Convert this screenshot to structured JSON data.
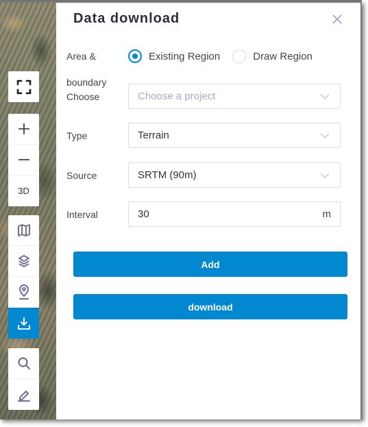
{
  "toolbar": {
    "groups": [
      [
        {
          "name": "fullscreen",
          "icon": "fullscreen-icon"
        }
      ],
      [
        {
          "name": "zoom-in",
          "icon": "plus-icon"
        },
        {
          "name": "zoom-out",
          "icon": "minus-icon"
        },
        {
          "name": "3d",
          "label": "3D"
        }
      ],
      [
        {
          "name": "basemap",
          "icon": "map-icon"
        },
        {
          "name": "layers",
          "icon": "layers-icon"
        },
        {
          "name": "location",
          "icon": "location-pin-icon"
        },
        {
          "name": "download",
          "icon": "download-icon",
          "active": true
        }
      ],
      [
        {
          "name": "search",
          "icon": "search-icon"
        },
        {
          "name": "draw",
          "icon": "edit-icon"
        }
      ]
    ],
    "label_3d": "3D"
  },
  "panel": {
    "title": "Data download",
    "close_icon": "close-icon",
    "area": {
      "label": "Area &",
      "options": [
        {
          "label": "Existing Region",
          "checked": true
        },
        {
          "label": "Draw Region",
          "checked": false
        }
      ]
    },
    "boundary": {
      "label_line1": "boundary",
      "label_line2": "Choose",
      "placeholder": "Choose a project",
      "value": ""
    },
    "type": {
      "label": "Type",
      "value": "Terrain"
    },
    "source": {
      "label": "Source",
      "value": "SRTM (90m)"
    },
    "interval": {
      "label": "Interval",
      "value": "30",
      "unit": "m"
    },
    "add_label": "Add",
    "download_label": "download"
  },
  "colors": {
    "accent": "#0288d1",
    "icon": "#6e7197",
    "title": "#2a2d3e",
    "border": "#dcdce6",
    "placeholder": "#a8a9bd"
  }
}
